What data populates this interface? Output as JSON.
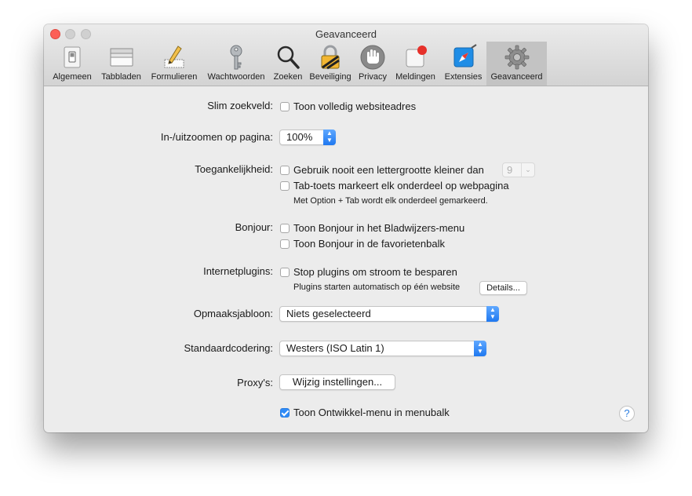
{
  "window": {
    "title": "Geavanceerd"
  },
  "toolbar": {
    "items": [
      {
        "label": "Algemeen",
        "icon": "general-switch-icon"
      },
      {
        "label": "Tabbladen",
        "icon": "tabs-icon"
      },
      {
        "label": "Formulieren",
        "icon": "pencil-form-icon"
      },
      {
        "label": "Wachtwoorden",
        "icon": "key-icon"
      },
      {
        "label": "Zoeken",
        "icon": "magnifier-icon"
      },
      {
        "label": "Beveiliging",
        "icon": "padlock-icon"
      },
      {
        "label": "Privacy",
        "icon": "hand-icon"
      },
      {
        "label": "Meldingen",
        "icon": "notification-badge-icon"
      },
      {
        "label": "Extensies",
        "icon": "compass-extension-icon"
      },
      {
        "label": "Geavanceerd",
        "icon": "gear-icon",
        "selected": true
      }
    ]
  },
  "settings": {
    "smart_search": {
      "label": "Slim zoekveld:",
      "checkbox": "Toon volledig websiteadres",
      "checked": false
    },
    "zoom": {
      "label": "In-/uitzoomen op pagina:",
      "value": "100%"
    },
    "accessibility": {
      "label": "Toegankelijkheid:",
      "min_font_checkbox": "Gebruik nooit een lettergrootte kleiner dan",
      "min_font_value": "9",
      "tab_checkbox": "Tab-toets markeert elk onderdeel op webpagina",
      "tab_note": "Met Option + Tab wordt elk onderdeel gemarkeerd."
    },
    "bonjour": {
      "label": "Bonjour:",
      "bookmarks_menu": "Toon Bonjour in het Bladwijzers-menu",
      "favorites_bar": "Toon Bonjour in de favorietenbalk"
    },
    "plugins": {
      "label": "Internetplugins:",
      "checkbox": "Stop plugins om stroom te besparen",
      "note": "Plugins starten automatisch op één website",
      "details_button": "Details..."
    },
    "style_sheet": {
      "label": "Opmaaksjabloon:",
      "value": "Niets geselecteerd"
    },
    "encoding": {
      "label": "Standaardcodering:",
      "value": "Westers (ISO Latin 1)"
    },
    "proxies": {
      "label": "Proxy's:",
      "button": "Wijzig instellingen..."
    },
    "develop_menu": {
      "checkbox": "Toon Ontwikkel-menu in menubalk",
      "checked": true
    }
  },
  "help_button": "?",
  "colors": {
    "accent": "#2f8bf7",
    "close": "#fc5f57",
    "selected_tab": "#c3c3c3"
  }
}
